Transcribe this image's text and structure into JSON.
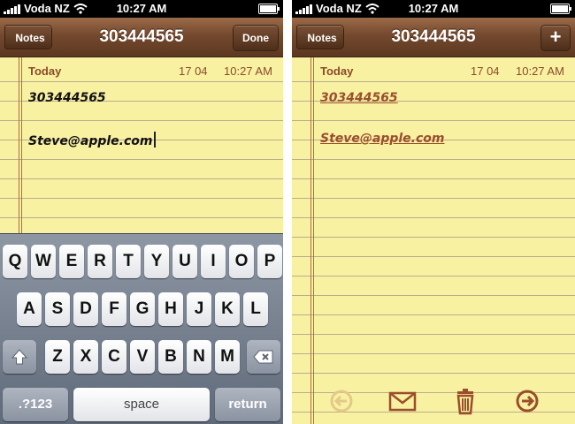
{
  "status_bar": {
    "carrier": "Voda NZ",
    "time": "10:27 AM"
  },
  "left_screen": {
    "back_button": "Notes",
    "title": "303444565",
    "done_button": "Done",
    "day_label": "Today",
    "date": "17 04",
    "time": "10:27 AM",
    "note_lines": [
      "303444565",
      "Steve@apple.com"
    ],
    "keyboard": {
      "row1": [
        "Q",
        "W",
        "E",
        "R",
        "T",
        "Y",
        "U",
        "I",
        "O",
        "P"
      ],
      "row2": [
        "A",
        "S",
        "D",
        "F",
        "G",
        "H",
        "J",
        "K",
        "L"
      ],
      "row3": [
        "Z",
        "X",
        "C",
        "V",
        "B",
        "N",
        "M"
      ],
      "numbers_key": ".?123",
      "space_key": "space",
      "return_key": "return",
      "shift_icon": "shift-arrow-icon",
      "delete_icon": "backspace-icon"
    }
  },
  "right_screen": {
    "back_button": "Notes",
    "title": "303444565",
    "add_button": "+",
    "day_label": "Today",
    "date": "17 04",
    "time": "10:27 AM",
    "note_links": [
      "303444565",
      "Steve@apple.com"
    ],
    "toolbar": [
      "previous-arrow-icon",
      "mail-envelope-icon",
      "trash-icon",
      "next-arrow-icon"
    ]
  },
  "colors": {
    "nav_brown": "#74492e",
    "paper_yellow": "#f9f1a2",
    "link_brown": "#9a4e2c",
    "keyboard_gray": "#7a8493"
  }
}
